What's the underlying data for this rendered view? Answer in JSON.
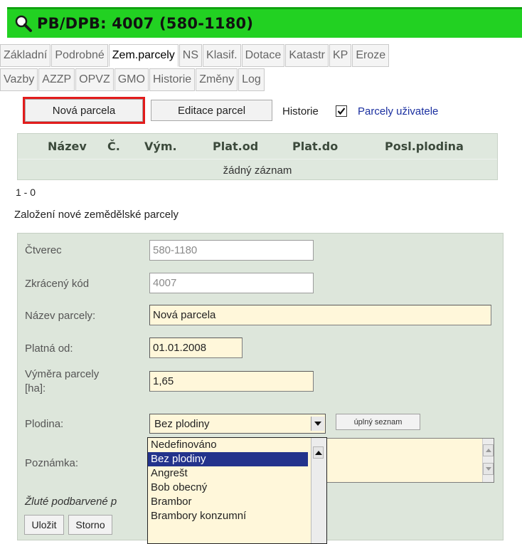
{
  "window": {
    "title": "PB/DPB: 4007 (580-1180)",
    "icon": "magnifier-icon",
    "title_bar_color": "#22d122"
  },
  "tabs_row1": [
    {
      "label": "Základní",
      "active": false
    },
    {
      "label": "Podrobné",
      "active": false
    },
    {
      "label": "Zem.parcely",
      "active": true
    },
    {
      "label": "NS",
      "active": false
    },
    {
      "label": "Klasif.",
      "active": false
    },
    {
      "label": "Dotace",
      "active": false
    },
    {
      "label": "Katastr",
      "active": false
    },
    {
      "label": "KP",
      "active": false
    },
    {
      "label": "Eroze",
      "active": false
    }
  ],
  "tabs_row2": [
    {
      "label": "Vazby"
    },
    {
      "label": "AZZP"
    },
    {
      "label": "OPVZ"
    },
    {
      "label": "GMO"
    },
    {
      "label": "Historie"
    },
    {
      "label": "Změny"
    },
    {
      "label": "Log"
    }
  ],
  "toolbar": {
    "new_label": "Nová parcela",
    "edit_label": "Editace parcel",
    "history_label": "Historie",
    "history_checked": true,
    "user_parcels_link": "Parcely uživatele"
  },
  "grid": {
    "columns": [
      "Název",
      "Č.",
      "Vým.",
      "Plat.od",
      "Plat.do",
      "Posl.plodina"
    ],
    "empty_text": "žádný záznam",
    "pager": "1 - 0"
  },
  "form": {
    "heading": "Založení nové zemědělské parcely",
    "ctverec": {
      "label": "Čtverec",
      "value": "580-1180"
    },
    "kod": {
      "label": "Zkrácený kód",
      "value": "4007"
    },
    "nazev": {
      "label": "Název parcely:",
      "value": "Nová parcela"
    },
    "platna": {
      "label": "Platná od:",
      "value": "01.01.2008"
    },
    "vymera": {
      "label_line1": "Výměra parcely",
      "label_line2": "[ha]:",
      "value": "1,65"
    },
    "plodina": {
      "label": "Plodina:",
      "value": "Bez plodiny",
      "full_list_button": "úplný seznam"
    },
    "poznamka": {
      "label": "Poznámka:"
    },
    "note": "Žluté podbarvené p",
    "save_label": "Uložit",
    "cancel_label": "Storno"
  },
  "dropdown": {
    "options": [
      "Nedefinováno",
      "Bez plodiny",
      "Angrešt",
      "Bob obecný",
      "Brambor",
      "Brambory konzumní"
    ],
    "selected_index": 1
  },
  "colors": {
    "form_background": "#dde6db",
    "required_field": "#fff7da",
    "highlight_outline": "#e21c1c",
    "selected_option": "#23338c"
  }
}
